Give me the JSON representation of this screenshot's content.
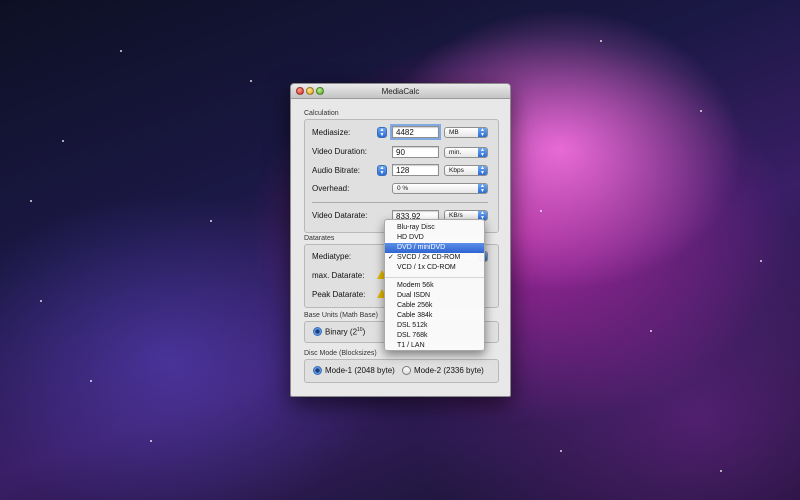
{
  "window": {
    "title": "MediaCalc"
  },
  "calculation": {
    "section_label": "Calculation",
    "mediasize": {
      "label": "Mediasize:",
      "value": "4482",
      "unit": "MB"
    },
    "video_duration": {
      "label": "Video Duration:",
      "value": "90",
      "unit": "min."
    },
    "audio_bitrate": {
      "label": "Audio Bitrate:",
      "value": "128",
      "unit": "Kbps"
    },
    "overhead": {
      "label": "Overhead:",
      "value": "0 %"
    },
    "video_datarate": {
      "label": "Video Datarate:",
      "value": "833.92",
      "unit": "KB/s"
    }
  },
  "datarates": {
    "section_label": "Datarates",
    "mediatype_label": "Mediatype:",
    "max_datarate_label": "max. Datarate:",
    "peak_datarate_label": "Peak Datarate:"
  },
  "base_units": {
    "section_label": "Base Units (Math Base)",
    "binary_label": "Binary (2",
    "binary_exponent": "10",
    "binary_close": ")"
  },
  "disc_mode": {
    "section_label": "Disc Mode (Blocksizes)",
    "mode1_label": "Mode-1 (2048 byte)",
    "mode2_label": "Mode-2 (2336 byte)"
  },
  "mediatype_menu": {
    "group1": [
      "Blu-ray Disc",
      "HD DVD",
      "DVD / miniDVD",
      "SVCD / 2x CD-ROM",
      "VCD / 1x CD-ROM"
    ],
    "group2": [
      "Modem 56k",
      "Dual ISDN",
      "Cable 256k",
      "Cable 384k",
      "DSL 512k",
      "DSL 768k",
      "T1 / LAN"
    ],
    "highlighted": "DVD / miniDVD",
    "checked": "SVCD / 2x CD-ROM",
    "check_mark": "✓"
  },
  "colors": {
    "accent": "#2f65d2",
    "warning": "#e6b800"
  }
}
